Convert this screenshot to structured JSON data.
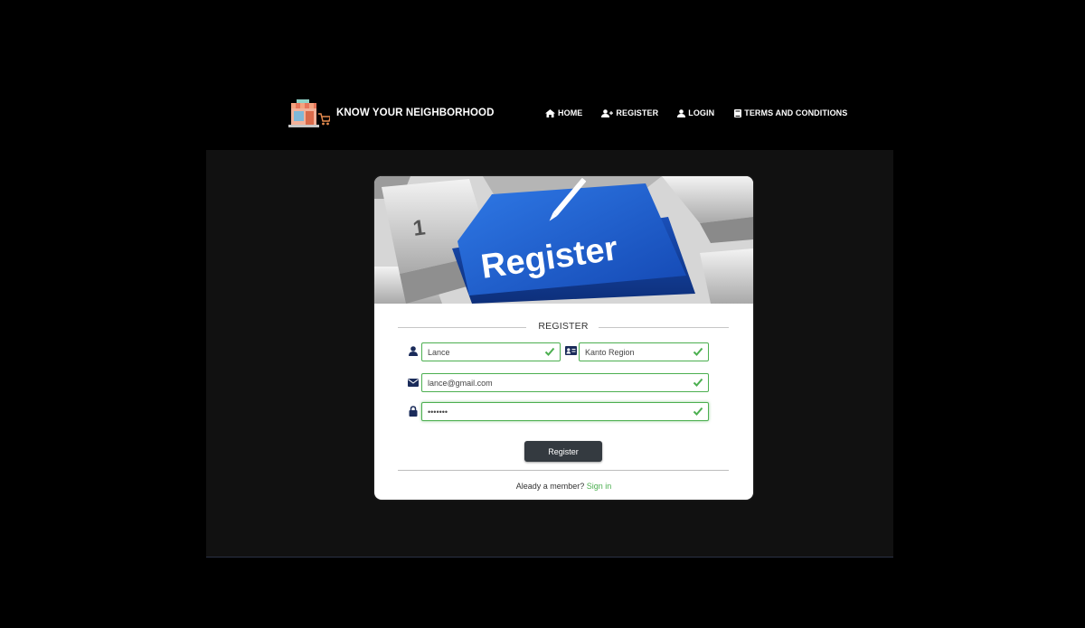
{
  "brand": {
    "name": "KNOW YOUR NEIGHBORHOOD"
  },
  "nav": {
    "home": "HOME",
    "register": "REGISTER",
    "login": "LOGIN",
    "terms": "TERMS AND CONDITIONS"
  },
  "hero": {
    "key_label": "Register",
    "key_neighbor": "1"
  },
  "form": {
    "title": "REGISTER",
    "name_value": "Lance",
    "region_value": "Kanto Region",
    "email_value": "lance@gmail.com",
    "password_value": "•••••••",
    "submit_label": "Register"
  },
  "footer": {
    "prompt": "Aleady a member?",
    "signin": "Sign in"
  },
  "colors": {
    "valid_border": "#4caf50",
    "button_bg": "#343a40",
    "link": "#4caf50",
    "key_blue": "#1f5fd1"
  }
}
